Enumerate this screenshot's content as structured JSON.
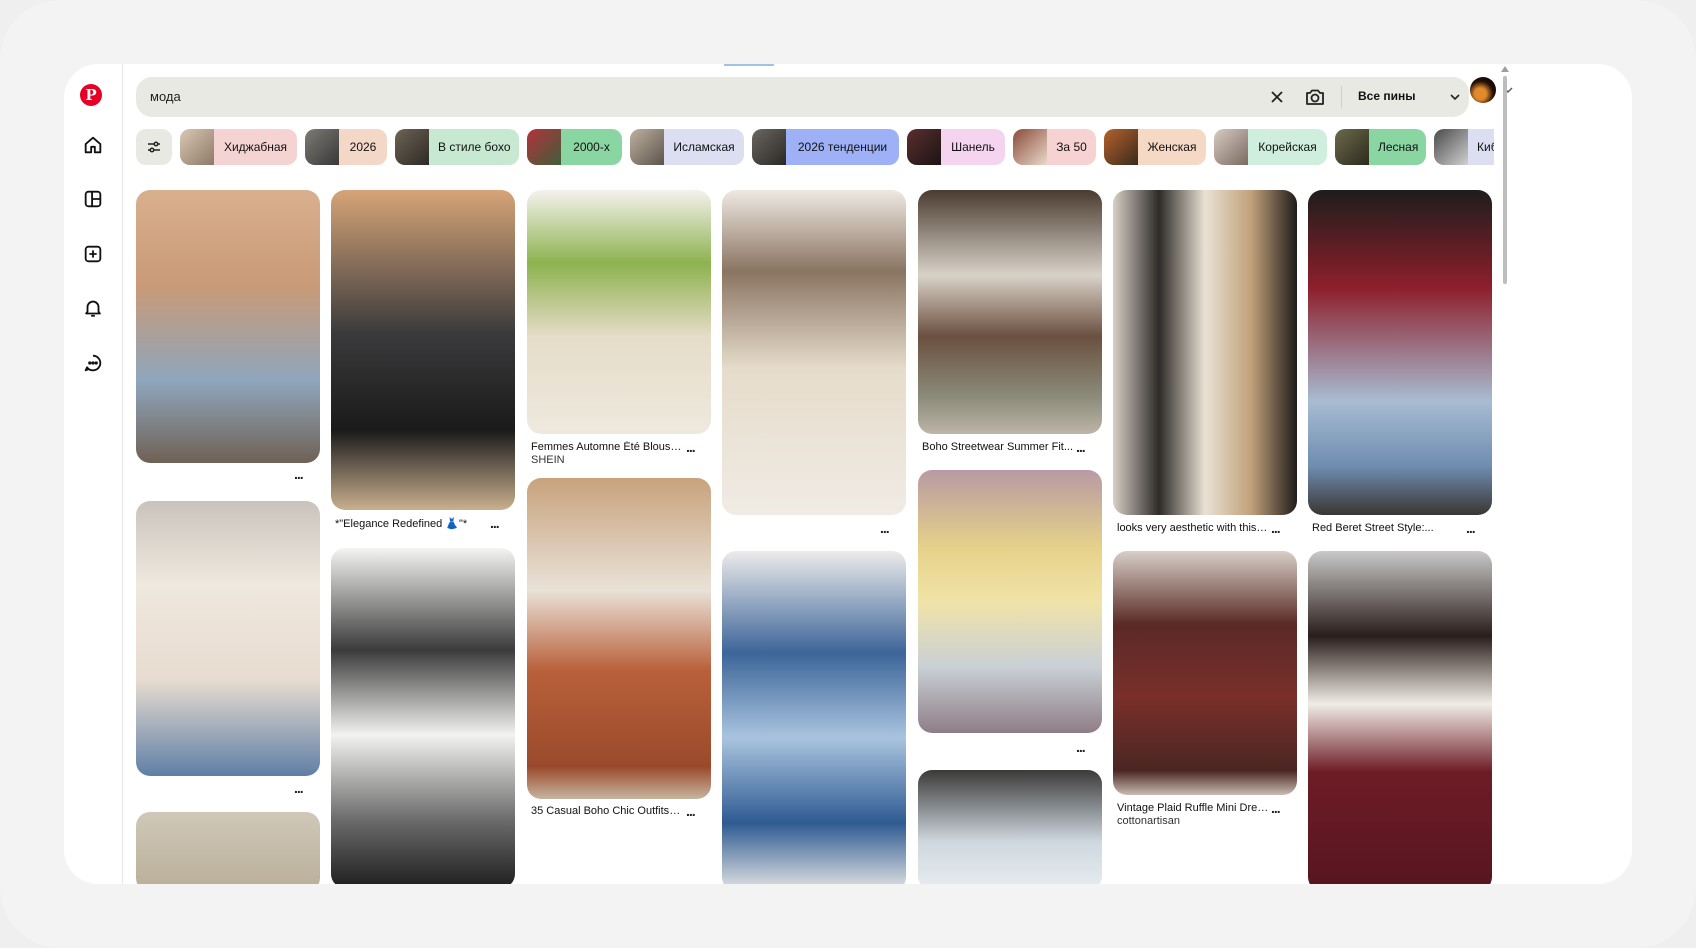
{
  "search": {
    "query": "мода",
    "filter_label": "Все пины",
    "icons": [
      "clear-icon",
      "camera-search-icon",
      "chevron-down-icon"
    ]
  },
  "sidebar": {
    "icons": [
      "pinterest-logo",
      "home-icon",
      "board-icon",
      "create-icon",
      "notifications-icon",
      "messages-icon"
    ]
  },
  "chips": [
    {
      "label": "Хиджабная",
      "color": "#f6d3d3"
    },
    {
      "label": "2026",
      "color": "#f3d8c8"
    },
    {
      "label": "В стиле бохо",
      "color": "#c7e8d1"
    },
    {
      "label": "2000-х",
      "color": "#8ad6a2"
    },
    {
      "label": "Исламская",
      "color": "#dcdff2"
    },
    {
      "label": "2026 тенденции",
      "color": "#9eb1f7"
    },
    {
      "label": "Шанель",
      "color": "#f4d4ef"
    },
    {
      "label": "За 50",
      "color": "#f7d2d2"
    },
    {
      "label": "Женская",
      "color": "#f6d9c5"
    },
    {
      "label": "Корейская",
      "color": "#cfeedd"
    },
    {
      "label": "Лесная",
      "color": "#8ad6a2"
    },
    {
      "label": "Киб",
      "color": "#dcdff2"
    }
  ],
  "pins": [
    {
      "title": "",
      "sub": ""
    },
    {
      "title": "",
      "sub": ""
    },
    {
      "title": "*\"Elegance Redefined 👗\"*",
      "sub": ""
    },
    {
      "title": "",
      "sub": ""
    },
    {
      "title": "Femmes Automne Été Blouse...",
      "sub": "SHEIN"
    },
    {
      "title": "35 Casual Boho Chic Outfits f...",
      "sub": ""
    },
    {
      "title": "",
      "sub": ""
    },
    {
      "title": "",
      "sub": ""
    },
    {
      "title": "Boho Streetwear Summer Fit...",
      "sub": ""
    },
    {
      "title": "",
      "sub": ""
    },
    {
      "title": "",
      "sub": ""
    },
    {
      "title": "looks very aesthetic with thiss...",
      "sub": ""
    },
    {
      "title": "Vintage Plaid Ruffle Mini Dress...",
      "sub": "cottonartisan"
    },
    {
      "title": "Red Beret Street Style:...",
      "sub": ""
    },
    {
      "title": "",
      "sub": ""
    }
  ],
  "more_label": "..."
}
